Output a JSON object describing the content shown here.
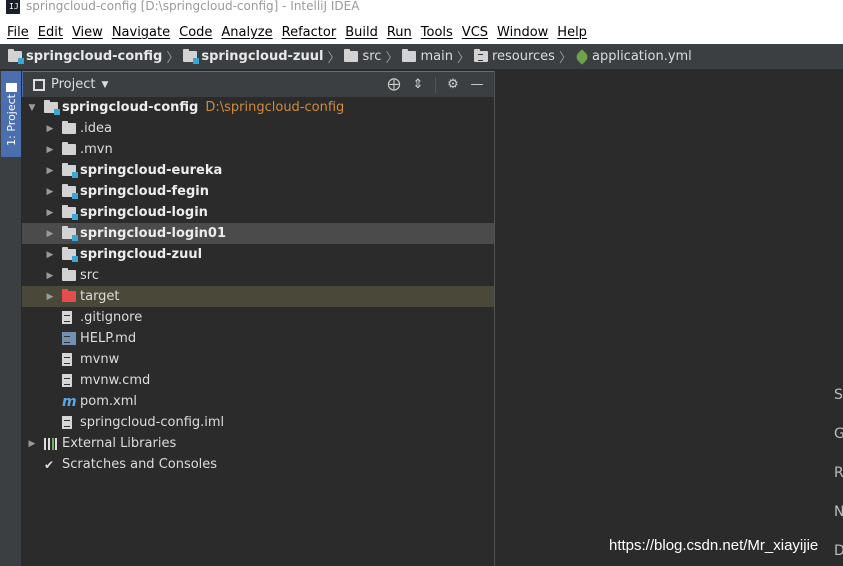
{
  "window": {
    "title": "springcloud-config [D:\\springcloud-config] - IntelliJ IDEA"
  },
  "menu": [
    "File",
    "Edit",
    "View",
    "Navigate",
    "Code",
    "Analyze",
    "Refactor",
    "Build",
    "Run",
    "Tools",
    "VCS",
    "Window",
    "Help"
  ],
  "breadcrumb": [
    {
      "label": "springcloud-config",
      "icon": "module-folder-icon"
    },
    {
      "label": "springcloud-zuul",
      "icon": "module-folder-icon"
    },
    {
      "label": "src",
      "icon": "folder-icon"
    },
    {
      "label": "main",
      "icon": "folder-icon"
    },
    {
      "label": "resources",
      "icon": "resources-folder-icon"
    },
    {
      "label": "application.yml",
      "icon": "spring-leaf-icon"
    }
  ],
  "toolwindow": {
    "stripe_label": "1: Project",
    "title": "Project",
    "tools": [
      "locate-icon",
      "collapse-icon",
      "gear-icon",
      "minimize-icon"
    ]
  },
  "tree": {
    "root": {
      "label": "springcloud-config",
      "path": "D:\\springcloud-config"
    },
    "items": [
      {
        "label": ".idea",
        "kind": "folder"
      },
      {
        "label": ".mvn",
        "kind": "folder"
      },
      {
        "label": "springcloud-eureka",
        "kind": "module"
      },
      {
        "label": "springcloud-fegin",
        "kind": "module"
      },
      {
        "label": "springcloud-login",
        "kind": "module"
      },
      {
        "label": "springcloud-login01",
        "kind": "module"
      },
      {
        "label": "springcloud-zuul",
        "kind": "module"
      },
      {
        "label": "src",
        "kind": "folder"
      },
      {
        "label": "target",
        "kind": "excluded-folder"
      },
      {
        "label": ".gitignore",
        "kind": "file"
      },
      {
        "label": "HELP.md",
        "kind": "markdown-file"
      },
      {
        "label": "mvnw",
        "kind": "file"
      },
      {
        "label": "mvnw.cmd",
        "kind": "file"
      },
      {
        "label": "pom.xml",
        "kind": "maven-file"
      },
      {
        "label": "springcloud-config.iml",
        "kind": "file"
      }
    ],
    "external_libraries": "External Libraries",
    "scratches": "Scratches and Consoles"
  },
  "editor": {
    "hints": [
      "S",
      "G",
      "R",
      "N",
      "D"
    ],
    "watermark": "https://blog.csdn.net/Mr_xiayijie"
  },
  "colors": {
    "accent": "#4b6eaf",
    "background": "#2b2b2b",
    "path_orange": "#d08b3a",
    "excluded_red": "#e34d4d"
  }
}
